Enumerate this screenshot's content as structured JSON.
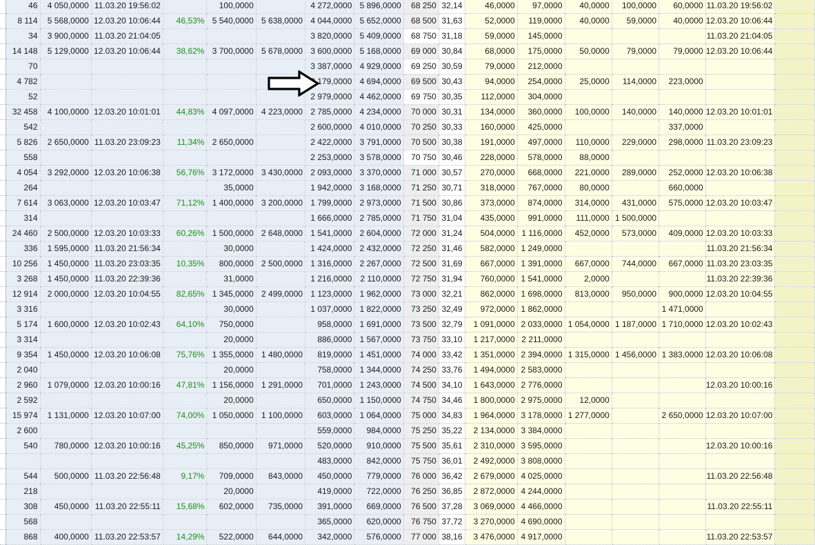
{
  "arrow": {
    "icon": "arrow-right-outline-icon"
  },
  "rows": [
    [
      "46",
      "4 050,0000",
      "11.03.20 19:56:02",
      "",
      "100,0000",
      "",
      "4 272,0000",
      "5 896,0000",
      "68 250",
      "32,14",
      "46,0000",
      "97,0000",
      "40,0000",
      "100,0000",
      "60,0000",
      "11.03.20 19:56:02"
    ],
    [
      "8 114",
      "5 568,0000",
      "12.03.20 10:06:44",
      "46,53%",
      "5 540,0000",
      "5 638,0000",
      "4 044,0000",
      "5 652,0000",
      "68 500",
      "31,63",
      "52,0000",
      "119,0000",
      "40,0000",
      "59,0000",
      "40,0000",
      "12.03.20 10:06:44"
    ],
    [
      "34",
      "3 900,0000",
      "11.03.20 21:04:05",
      "",
      "",
      "",
      "3 820,0000",
      "5 409,0000",
      "68 750",
      "31,18",
      "59,0000",
      "145,0000",
      "",
      "",
      "",
      "11.03.20 21:04:05"
    ],
    [
      "14 148",
      "5 129,0000",
      "12.03.20 10:06:44",
      "38,62%",
      "3 700,0000",
      "5 678,0000",
      "3 600,0000",
      "5 168,0000",
      "69 000",
      "30,84",
      "68,0000",
      "175,0000",
      "50,0000",
      "79,0000",
      "79,0000",
      "12.03.20 10:06:44"
    ],
    [
      "70",
      "",
      "",
      "",
      "",
      "",
      "3 387,0000",
      "4 929,0000",
      "69 250",
      "30,59",
      "79,0000",
      "212,0000",
      "",
      "",
      "",
      ""
    ],
    [
      "4 782",
      "",
      "",
      "",
      "",
      "",
      "3 179,0000",
      "4 694,0000",
      "69 500",
      "30,43",
      "94,0000",
      "254,0000",
      "25,0000",
      "114,0000",
      "223,0000",
      ""
    ],
    [
      "52",
      "",
      "",
      "",
      "",
      "",
      "2 979,0000",
      "4 462,0000",
      "69 750",
      "30,35",
      "112,0000",
      "304,0000",
      "",
      "",
      "",
      ""
    ],
    [
      "32 458",
      "4 100,0000",
      "12.03.20 10:01:01",
      "44,83%",
      "4 097,0000",
      "4 223,0000",
      "2 785,0000",
      "4 234,0000",
      "70 000",
      "30,31",
      "134,0000",
      "360,0000",
      "100,0000",
      "140,0000",
      "140,0000",
      "12.03.20 10:01:01"
    ],
    [
      "542",
      "",
      "",
      "",
      "",
      "",
      "2 600,0000",
      "4 010,0000",
      "70 250",
      "30,33",
      "160,0000",
      "425,0000",
      "",
      "",
      "337,0000",
      ""
    ],
    [
      "5 826",
      "2 650,0000",
      "11.03.20 23:09:23",
      "11,34%",
      "2 650,0000",
      "",
      "2 422,0000",
      "3 791,0000",
      "70 500",
      "30,38",
      "191,0000",
      "497,0000",
      "110,0000",
      "229,0000",
      "298,0000",
      "11.03.20 23:09:23"
    ],
    [
      "558",
      "",
      "",
      "",
      "",
      "",
      "2 253,0000",
      "3 578,0000",
      "70 750",
      "30,46",
      "228,0000",
      "578,0000",
      "88,0000",
      "",
      "",
      ""
    ],
    [
      "4 054",
      "3 292,0000",
      "12.03.20 10:06:38",
      "56,76%",
      "3 172,0000",
      "3 430,0000",
      "2 093,0000",
      "3 370,0000",
      "71 000",
      "30,57",
      "270,0000",
      "668,0000",
      "221,0000",
      "289,0000",
      "252,0000",
      "12.03.20 10:06:38"
    ],
    [
      "264",
      "",
      "",
      "",
      "35,0000",
      "",
      "1 942,0000",
      "3 168,0000",
      "71 250",
      "30,71",
      "318,0000",
      "767,0000",
      "80,0000",
      "",
      "660,0000",
      ""
    ],
    [
      "7 614",
      "3 063,0000",
      "12.03.20 10:03:47",
      "71,12%",
      "1 400,0000",
      "3 200,0000",
      "1 799,0000",
      "2 973,0000",
      "71 500",
      "30,86",
      "373,0000",
      "874,0000",
      "314,0000",
      "431,0000",
      "575,0000",
      "12.03.20 10:03:47"
    ],
    [
      "314",
      "",
      "",
      "",
      "",
      "",
      "1 666,0000",
      "2 785,0000",
      "71 750",
      "31,04",
      "435,0000",
      "991,0000",
      "111,0000",
      "1 500,0000",
      "",
      ""
    ],
    [
      "24 460",
      "2 500,0000",
      "12.03.20 10:03:33",
      "60,26%",
      "1 500,0000",
      "2 648,0000",
      "1 541,0000",
      "2 604,0000",
      "72 000",
      "31,24",
      "504,0000",
      "1 116,0000",
      "452,0000",
      "573,0000",
      "409,0000",
      "12.03.20 10:03:33"
    ],
    [
      "336",
      "1 595,0000",
      "11.03.20 21:56:34",
      "",
      "30,0000",
      "",
      "1 424,0000",
      "2 432,0000",
      "72 250",
      "31,46",
      "582,0000",
      "1 249,0000",
      "",
      "",
      "",
      "11.03.20 21:56:34"
    ],
    [
      "10 256",
      "1 450,0000",
      "11.03.20 23:03:35",
      "10,35%",
      "800,0000",
      "2 500,0000",
      "1 316,0000",
      "2 267,0000",
      "72 500",
      "31,69",
      "667,0000",
      "1 391,0000",
      "667,0000",
      "744,0000",
      "667,0000",
      "11.03.20 23:03:35"
    ],
    [
      "3 268",
      "1 450,0000",
      "11.03.20 22:39:36",
      "",
      "31,0000",
      "",
      "1 216,0000",
      "2 110,0000",
      "72 750",
      "31,94",
      "760,0000",
      "1 541,0000",
      "2,0000",
      "",
      "",
      "11.03.20 22:39:36"
    ],
    [
      "12 914",
      "2 000,0000",
      "12.03.20 10:04:55",
      "82,65%",
      "1 345,0000",
      "2 499,0000",
      "1 123,0000",
      "1 962,0000",
      "73 000",
      "32,21",
      "862,0000",
      "1 698,0000",
      "813,0000",
      "950,0000",
      "900,0000",
      "12.03.20 10:04:55"
    ],
    [
      "3 316",
      "",
      "",
      "",
      "30,0000",
      "",
      "1 037,0000",
      "1 822,0000",
      "73 250",
      "32,49",
      "972,0000",
      "1 862,0000",
      "",
      "",
      "1 471,0000",
      ""
    ],
    [
      "5 174",
      "1 600,0000",
      "12.03.20 10:02:43",
      "64,10%",
      "750,0000",
      "",
      "958,0000",
      "1 691,0000",
      "73 500",
      "32,79",
      "1 091,0000",
      "2 033,0000",
      "1 054,0000",
      "1 187,0000",
      "1 710,0000",
      "12.03.20 10:02:43"
    ],
    [
      "3 314",
      "",
      "",
      "",
      "20,0000",
      "",
      "886,0000",
      "1 567,0000",
      "73 750",
      "33,10",
      "1 217,0000",
      "2 211,0000",
      "",
      "",
      "",
      ""
    ],
    [
      "9 354",
      "1 450,0000",
      "12.03.20 10:06:08",
      "75,76%",
      "1 355,0000",
      "1 480,0000",
      "819,0000",
      "1 451,0000",
      "74 000",
      "33,42",
      "1 351,0000",
      "2 394,0000",
      "1 315,0000",
      "1 456,0000",
      "1 383,0000",
      "12.03.20 10:06:08"
    ],
    [
      "2 040",
      "",
      "",
      "",
      "20,0000",
      "",
      "758,0000",
      "1 344,0000",
      "74 250",
      "33,76",
      "1 494,0000",
      "2 583,0000",
      "",
      "",
      "",
      ""
    ],
    [
      "2 960",
      "1 079,0000",
      "12.03.20 10:00:16",
      "47,81%",
      "1 156,0000",
      "1 291,0000",
      "701,0000",
      "1 243,0000",
      "74 500",
      "34,10",
      "1 643,0000",
      "2 776,0000",
      "",
      "",
      "",
      "12.03.20 10:00:16"
    ],
    [
      "2 592",
      "",
      "",
      "",
      "20,0000",
      "",
      "650,0000",
      "1 150,0000",
      "74 750",
      "34,46",
      "1 800,0000",
      "2 975,0000",
      "12,0000",
      "",
      "",
      ""
    ],
    [
      "15 974",
      "1 131,0000",
      "12.03.20 10:07:00",
      "74,00%",
      "1 050,0000",
      "1 100,0000",
      "603,0000",
      "1 064,0000",
      "75 000",
      "34,83",
      "1 964,0000",
      "3 178,0000",
      "1 277,0000",
      "",
      "2 650,0000",
      "12.03.20 10:07:00"
    ],
    [
      "2 600",
      "",
      "",
      "",
      "",
      "",
      "559,0000",
      "984,0000",
      "75 250",
      "35,22",
      "2 134,0000",
      "3 384,0000",
      "",
      "",
      "",
      ""
    ],
    [
      "540",
      "780,0000",
      "12.03.20 10:00:16",
      "45,25%",
      "850,0000",
      "971,0000",
      "520,0000",
      "910,0000",
      "75 500",
      "35,61",
      "2 310,0000",
      "3 595,0000",
      "",
      "",
      "",
      "12.03.20 10:00:16"
    ],
    [
      "",
      "",
      "",
      "",
      "",
      "",
      "483,0000",
      "842,0000",
      "75 750",
      "36,01",
      "2 492,0000",
      "3 808,0000",
      "",
      "",
      "",
      ""
    ],
    [
      "544",
      "500,0000",
      "11.03.20 22:56:48",
      "9,17%",
      "709,0000",
      "843,0000",
      "450,0000",
      "779,0000",
      "76 000",
      "36,42",
      "2 679,0000",
      "4 025,0000",
      "",
      "",
      "",
      "11.03.20 22:56:48"
    ],
    [
      "218",
      "",
      "",
      "",
      "20,0000",
      "",
      "419,0000",
      "722,0000",
      "76 250",
      "36,85",
      "2 872,0000",
      "4 244,0000",
      "",
      "",
      "",
      ""
    ],
    [
      "308",
      "450,0000",
      "11.03.20 22:55:11",
      "15,68%",
      "602,0000",
      "735,0000",
      "391,0000",
      "669,0000",
      "76 500",
      "37,28",
      "3 069,0000",
      "4 466,0000",
      "",
      "",
      "",
      "11.03.20 22:55:11"
    ],
    [
      "568",
      "",
      "",
      "",
      "",
      "",
      "365,0000",
      "620,0000",
      "76 750",
      "37,72",
      "3 270,0000",
      "4 690,0000",
      "",
      "",
      "",
      ""
    ],
    [
      "868",
      "400,0000",
      "11.03.20 22:53:57",
      "14,29%",
      "522,0000",
      "644,0000",
      "342,0000",
      "576,0000",
      "77 000",
      "38,16",
      "3 476,0000",
      "4 917,0000",
      "",
      "",
      "",
      "11.03.20 22:53:57"
    ]
  ]
}
